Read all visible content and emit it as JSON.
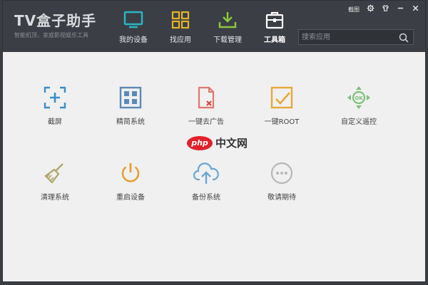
{
  "app": {
    "title": "TV盒子助手",
    "slogan": "智能机顶，家庭影视娱乐工具"
  },
  "window_controls": {
    "screenshot_label": "截图"
  },
  "nav": [
    {
      "label": "我的设备",
      "icon": "tv-icon"
    },
    {
      "label": "找应用",
      "icon": "grid-icon"
    },
    {
      "label": "下载管理",
      "icon": "download-icon"
    },
    {
      "label": "工具箱",
      "icon": "toolbox-icon",
      "active": true
    }
  ],
  "search": {
    "placeholder": "搜索应用"
  },
  "tools": [
    {
      "label": "截屏",
      "icon": "screenshot-icon",
      "color": "#3a8fc8"
    },
    {
      "label": "精简系统",
      "icon": "grid-icon",
      "color": "#5a8ab8"
    },
    {
      "label": "一键去广告",
      "icon": "remove-ad-icon",
      "color": "#e0776e"
    },
    {
      "label": "一键ROOT",
      "icon": "root-check-icon",
      "color": "#e6a83a"
    },
    {
      "label": "自定义遥控",
      "icon": "remote-control-icon",
      "color": "#7dc07a"
    },
    {
      "label": "清理系统",
      "icon": "broom-icon",
      "color": "#b0a66a"
    },
    {
      "label": "重启设备",
      "icon": "power-icon",
      "color": "#e6a030"
    },
    {
      "label": "备份系统",
      "icon": "cloud-upload-icon",
      "color": "#6aa6d8"
    },
    {
      "label": "敬请期待",
      "icon": "more-icon",
      "color": "#b8b8b8"
    }
  ],
  "watermark": {
    "badge": "php",
    "text": "中文网"
  }
}
